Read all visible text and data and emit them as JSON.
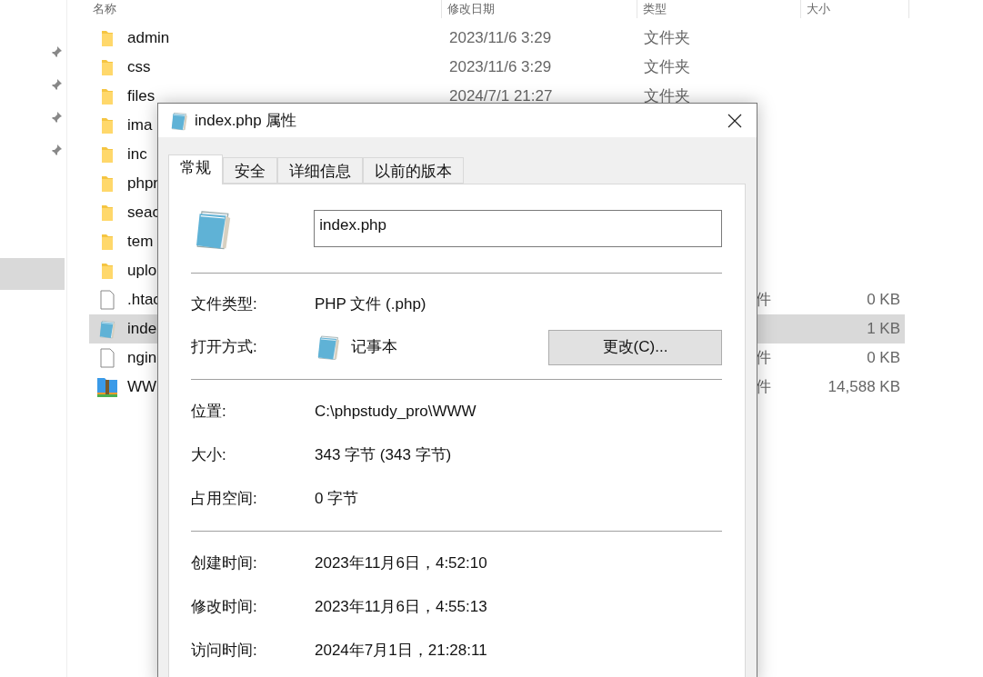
{
  "explorer": {
    "nav_selected_row": true,
    "columns": [
      "名称",
      "修改日期",
      "类型",
      "大小"
    ],
    "rows": [
      {
        "kind": "folder",
        "name": "admin",
        "modified": "2023/11/6 3:29",
        "type": "文件夹",
        "size": "",
        "selected": false
      },
      {
        "kind": "folder",
        "name": "css",
        "modified": "2023/11/6 3:29",
        "type": "文件夹",
        "size": "",
        "selected": false
      },
      {
        "kind": "folder",
        "name": "files",
        "modified": "2024/7/1 21:27",
        "type": "文件夹",
        "size": "",
        "selected": false
      },
      {
        "kind": "folder",
        "name": "ima",
        "modified": "",
        "type": "",
        "size": "",
        "selected": false
      },
      {
        "kind": "folder",
        "name": "inc",
        "modified": "",
        "type": "",
        "size": "",
        "selected": false
      },
      {
        "kind": "folder",
        "name": "phpr",
        "modified": "",
        "type": "",
        "size": "",
        "selected": false
      },
      {
        "kind": "folder",
        "name": "seac",
        "modified": "",
        "type": "",
        "size": "",
        "selected": false
      },
      {
        "kind": "folder",
        "name": "tem",
        "modified": "",
        "type": "",
        "size": "",
        "selected": false
      },
      {
        "kind": "folder",
        "name": "uplo",
        "modified": "",
        "type": "",
        "size": "",
        "selected": false
      },
      {
        "kind": "file",
        "name": ".htac",
        "modified": "",
        "type": "件",
        "size": "0 KB",
        "selected": false
      },
      {
        "kind": "notepad",
        "name": "inde",
        "modified": "",
        "type": "",
        "size": "1 KB",
        "selected": true
      },
      {
        "kind": "file",
        "name": "ngin",
        "modified": "",
        "type": "件",
        "size": "0 KB",
        "selected": false
      },
      {
        "kind": "archive",
        "name": "WW",
        "modified": "",
        "type": "件",
        "size": "14,588 KB",
        "selected": false
      }
    ]
  },
  "dialog": {
    "title": "index.php 属性",
    "tabs": [
      {
        "label": "常规",
        "selected": true
      },
      {
        "label": "安全",
        "selected": false
      },
      {
        "label": "详细信息",
        "selected": false
      },
      {
        "label": "以前的版本",
        "selected": false
      }
    ],
    "filename": "index.php",
    "file_type": {
      "label": "文件类型:",
      "value": "PHP 文件 (.php)"
    },
    "opens_with": {
      "label": "打开方式:",
      "value": "记事本",
      "button": "更改(C)..."
    },
    "groups": [
      [
        {
          "label": "位置:",
          "value": "C:\\phpstudy_pro\\WWW"
        },
        {
          "label": "大小:",
          "value": "343 字节 (343 字节)"
        },
        {
          "label": "占用空间:",
          "value": "0 字节"
        }
      ],
      [
        {
          "label": "创建时间:",
          "value": "2023年11月6日，4:52:10"
        },
        {
          "label": "修改时间:",
          "value": "2023年11月6日，4:55:13"
        },
        {
          "label": "访问时间:",
          "value": "2024年7月1日，21:28:11"
        }
      ]
    ]
  }
}
